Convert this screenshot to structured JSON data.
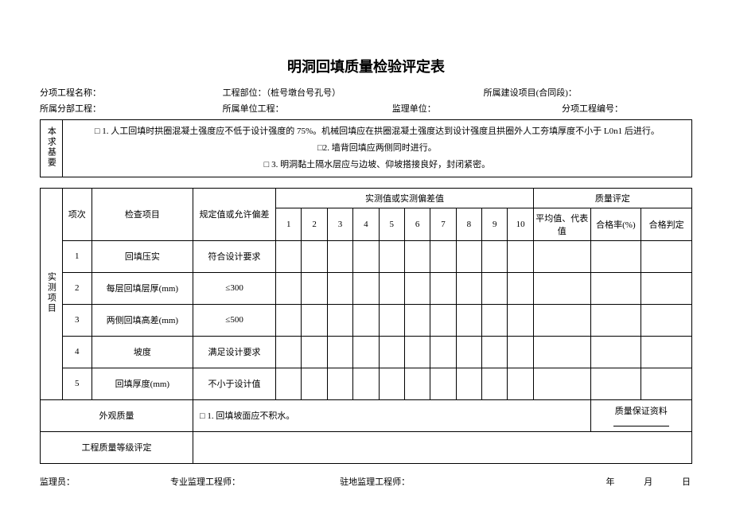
{
  "title": "明洞回填质量检验评定表",
  "meta": {
    "row1": {
      "l1": "分项工程名称：",
      "l2": "工程部位：（桩号墩台号孔号）",
      "l3": "所属建设项目(合同段)："
    },
    "row2": {
      "l1": "所属分部工程：",
      "l2": "所属单位工程：",
      "l3": "监理单位：",
      "l4": "分项工程编号："
    }
  },
  "basicReqLabel": "本求基要",
  "basicReqs": {
    "r1": "□ 1. 人工回填时拱圈混凝土强度应不低于设计强度的 75%。机械回填应在拱圈混凝土强度达到设计强度且拱圈外人工夯填厚度不小于 L0n1 后进行。",
    "r2": "□2. 墙背回填应两侧同时进行。",
    "r3": "□ 3. 明洞黏土隔水层应与边坡、仰坡搭接良好，封闭紧密。"
  },
  "measuredLabel": "实测项目",
  "headers": {
    "seq": "项次",
    "item": "检查项目",
    "spec": "规定值或允许偏差",
    "measured": "实测值或实测偏差值",
    "quality": "质量评定",
    "avg": "平均值、代表值",
    "passRate": "合格率(%)",
    "passJudge": "合格判定",
    "n": [
      "1",
      "2",
      "3",
      "4",
      "5",
      "6",
      "7",
      "8",
      "9",
      "10"
    ]
  },
  "rows": [
    {
      "seq": "1",
      "item": "回填压实",
      "spec": "符合设计要求"
    },
    {
      "seq": "2",
      "item": "每层回填层厚(mm)",
      "spec": "≤300"
    },
    {
      "seq": "3",
      "item": "两侧回填高差(mm)",
      "spec": "≤500"
    },
    {
      "seq": "4",
      "item": "坡度",
      "spec": "满足设计要求"
    },
    {
      "seq": "5",
      "item": "回填厚度(mm)",
      "spec": "不小于设计值"
    }
  ],
  "appearance": {
    "label": "外观质量",
    "text": "□ 1. 回填坡面应不积水。",
    "qa": "质量保证资料"
  },
  "gradeLabel": "工程质量等级评定",
  "footer": {
    "f1": "监理员：",
    "f2": "专业监理工程师：",
    "f3": "驻地监理工程师：",
    "f4y": "年",
    "f4m": "月",
    "f4d": "日"
  }
}
